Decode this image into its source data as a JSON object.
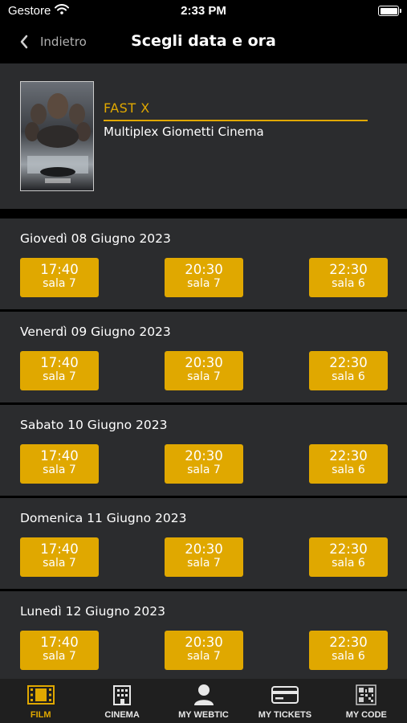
{
  "status": {
    "carrier": "Gestore",
    "time": "2:33 PM"
  },
  "nav": {
    "back_label": "Indietro",
    "title": "Scegli data e ora"
  },
  "movie": {
    "title": "FAST X",
    "cinema": "Multiplex Giometti Cinema"
  },
  "days": [
    {
      "date": "Giovedì 08 Giugno 2023",
      "showtimes": [
        {
          "time": "17:40",
          "hall": "sala 7"
        },
        {
          "time": "20:30",
          "hall": "sala 7"
        },
        {
          "time": "22:30",
          "hall": "sala 6"
        }
      ]
    },
    {
      "date": "Venerdì 09 Giugno 2023",
      "showtimes": [
        {
          "time": "17:40",
          "hall": "sala 7"
        },
        {
          "time": "20:30",
          "hall": "sala 7"
        },
        {
          "time": "22:30",
          "hall": "sala 6"
        }
      ]
    },
    {
      "date": "Sabato 10 Giugno 2023",
      "showtimes": [
        {
          "time": "17:40",
          "hall": "sala 7"
        },
        {
          "time": "20:30",
          "hall": "sala 7"
        },
        {
          "time": "22:30",
          "hall": "sala 6"
        }
      ]
    },
    {
      "date": "Domenica 11 Giugno 2023",
      "showtimes": [
        {
          "time": "17:40",
          "hall": "sala 7"
        },
        {
          "time": "20:30",
          "hall": "sala 7"
        },
        {
          "time": "22:30",
          "hall": "sala 6"
        }
      ]
    },
    {
      "date": "Lunedì 12 Giugno 2023",
      "showtimes": [
        {
          "time": "17:40",
          "hall": "sala 7"
        },
        {
          "time": "20:30",
          "hall": "sala 7"
        },
        {
          "time": "22:30",
          "hall": "sala 6"
        }
      ]
    }
  ],
  "tabs": [
    {
      "label": "FILM",
      "icon": "film-icon",
      "active": true
    },
    {
      "label": "CINEMA",
      "icon": "cinema-building-icon",
      "active": false
    },
    {
      "label": "MY WEBTIC",
      "icon": "user-icon",
      "active": false
    },
    {
      "label": "MY TICKETS",
      "icon": "ticket-card-icon",
      "active": false
    },
    {
      "label": "MY CODE",
      "icon": "qr-code-icon",
      "active": false
    }
  ],
  "colors": {
    "accent": "#e0a800",
    "panel": "#2b2c2e",
    "background": "#000000",
    "tabbar": "#1f1f1f"
  }
}
